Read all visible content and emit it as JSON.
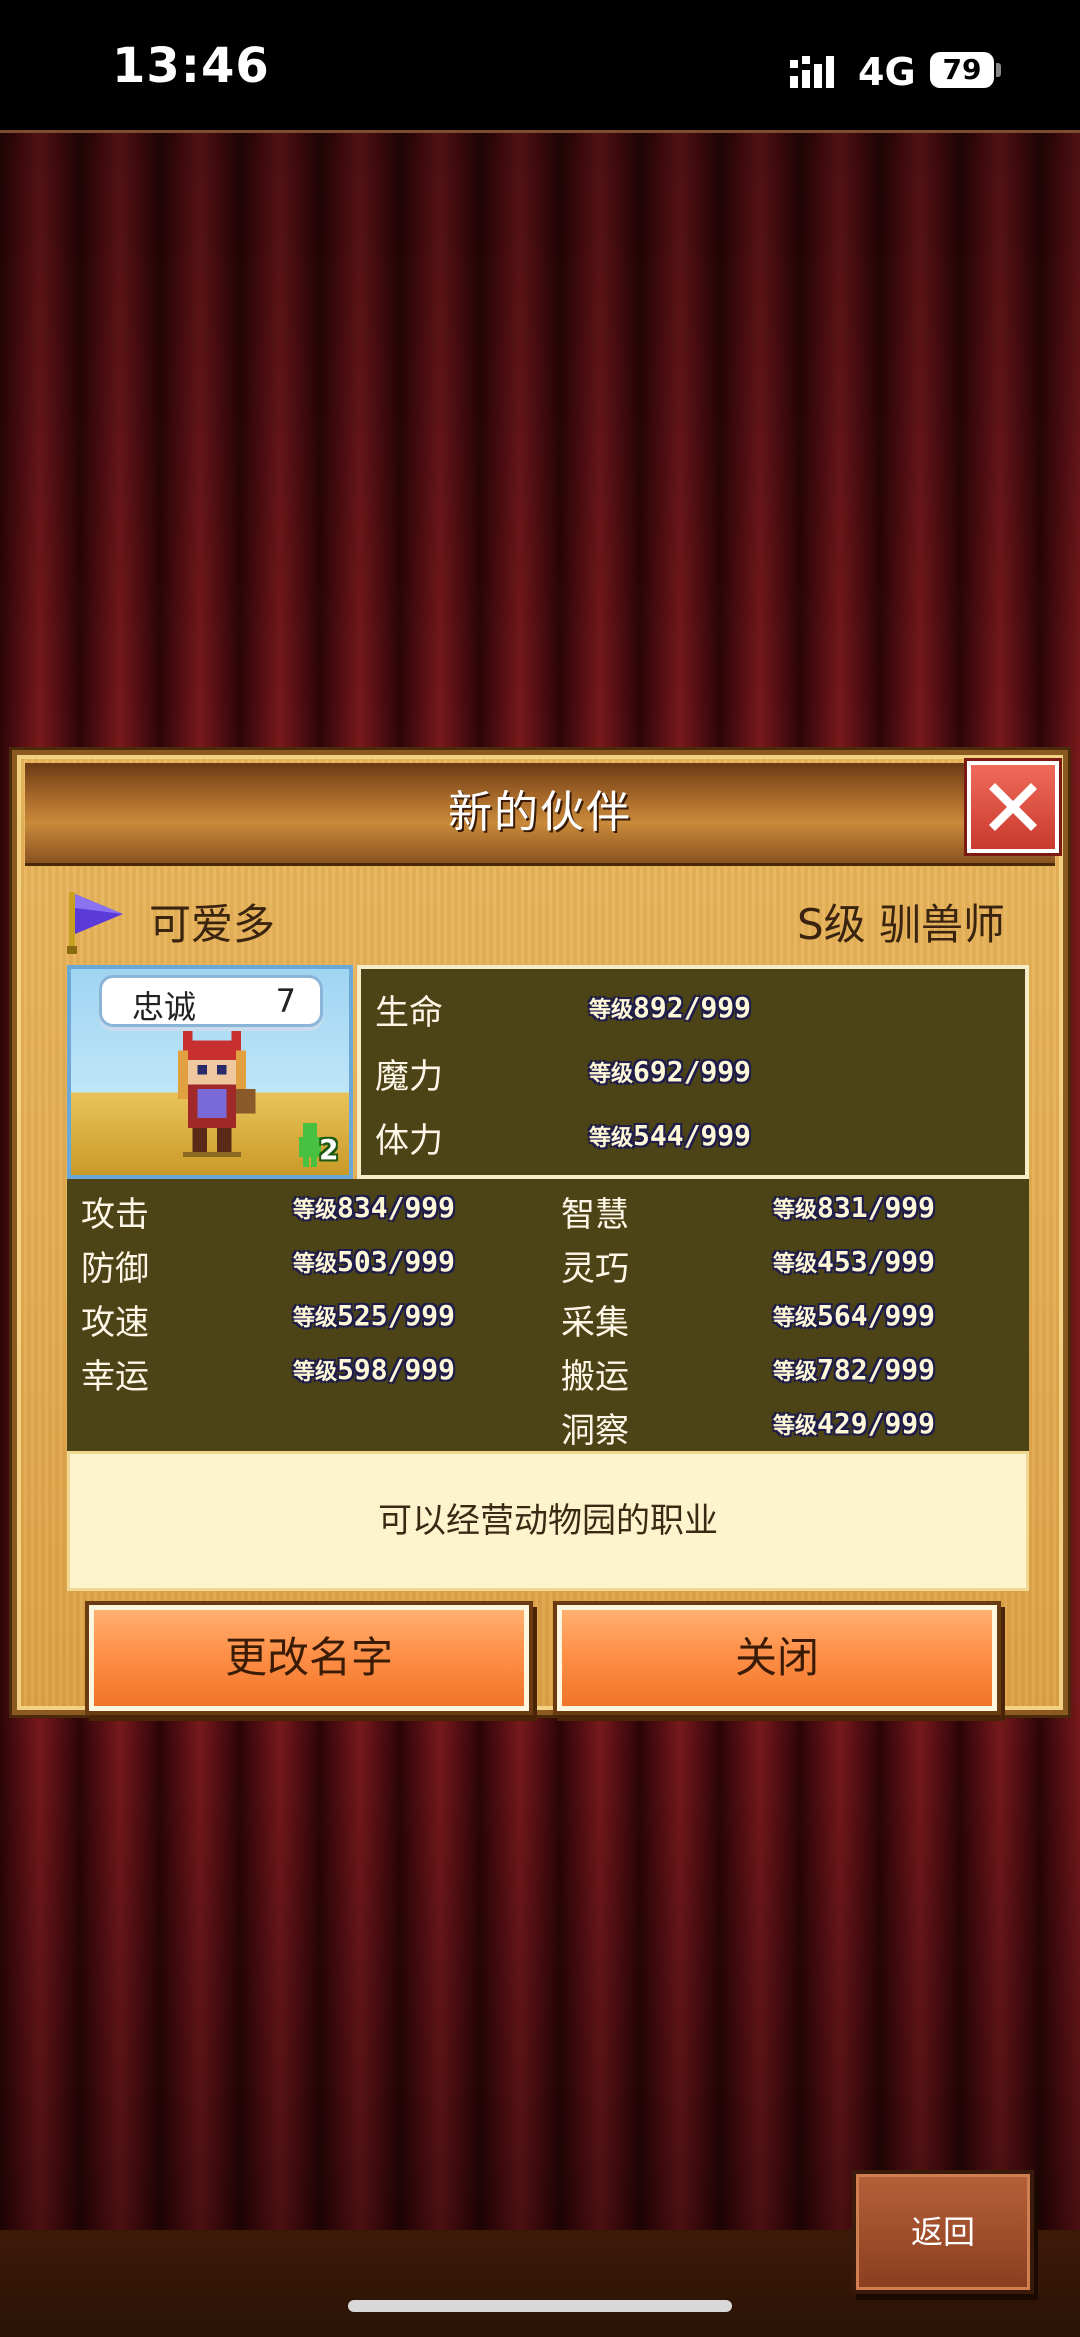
{
  "status_bar": {
    "time": "13:46",
    "network": "4G",
    "battery": "79"
  },
  "dialog": {
    "title": "新的伙伴",
    "character": {
      "name": "可爱多",
      "rank_class": "S级 驯兽师",
      "loyalty_label": "忠诚",
      "loyalty_value": "7",
      "member_count": "2"
    },
    "level_prefix": "等级",
    "stats_primary": [
      {
        "label": "生命",
        "value": "892",
        "max": "999"
      },
      {
        "label": "魔力",
        "value": "692",
        "max": "999"
      },
      {
        "label": "体力",
        "value": "544",
        "max": "999"
      }
    ],
    "stats_left": [
      {
        "label": "攻击",
        "value": "834",
        "max": "999"
      },
      {
        "label": "防御",
        "value": "503",
        "max": "999"
      },
      {
        "label": "攻速",
        "value": "525",
        "max": "999"
      },
      {
        "label": "幸运",
        "value": "598",
        "max": "999"
      }
    ],
    "stats_right": [
      {
        "label": "智慧",
        "value": "831",
        "max": "999"
      },
      {
        "label": "灵巧",
        "value": "453",
        "max": "999"
      },
      {
        "label": "采集",
        "value": "564",
        "max": "999"
      },
      {
        "label": "搬运",
        "value": "782",
        "max": "999"
      },
      {
        "label": "洞察",
        "value": "429",
        "max": "999"
      }
    ],
    "description": "可以经营动物园的职业",
    "rename_button": "更改名字",
    "close_button": "关闭"
  },
  "back_button": "返回",
  "colors": {
    "stat_panel": "#4c4416",
    "button_orange": "#ff9048",
    "close_red": "#e0524a",
    "flag_purple": "#5a3ad8"
  },
  "icons": {
    "close": "close-icon",
    "flag": "flag-icon",
    "member": "person-icon"
  }
}
